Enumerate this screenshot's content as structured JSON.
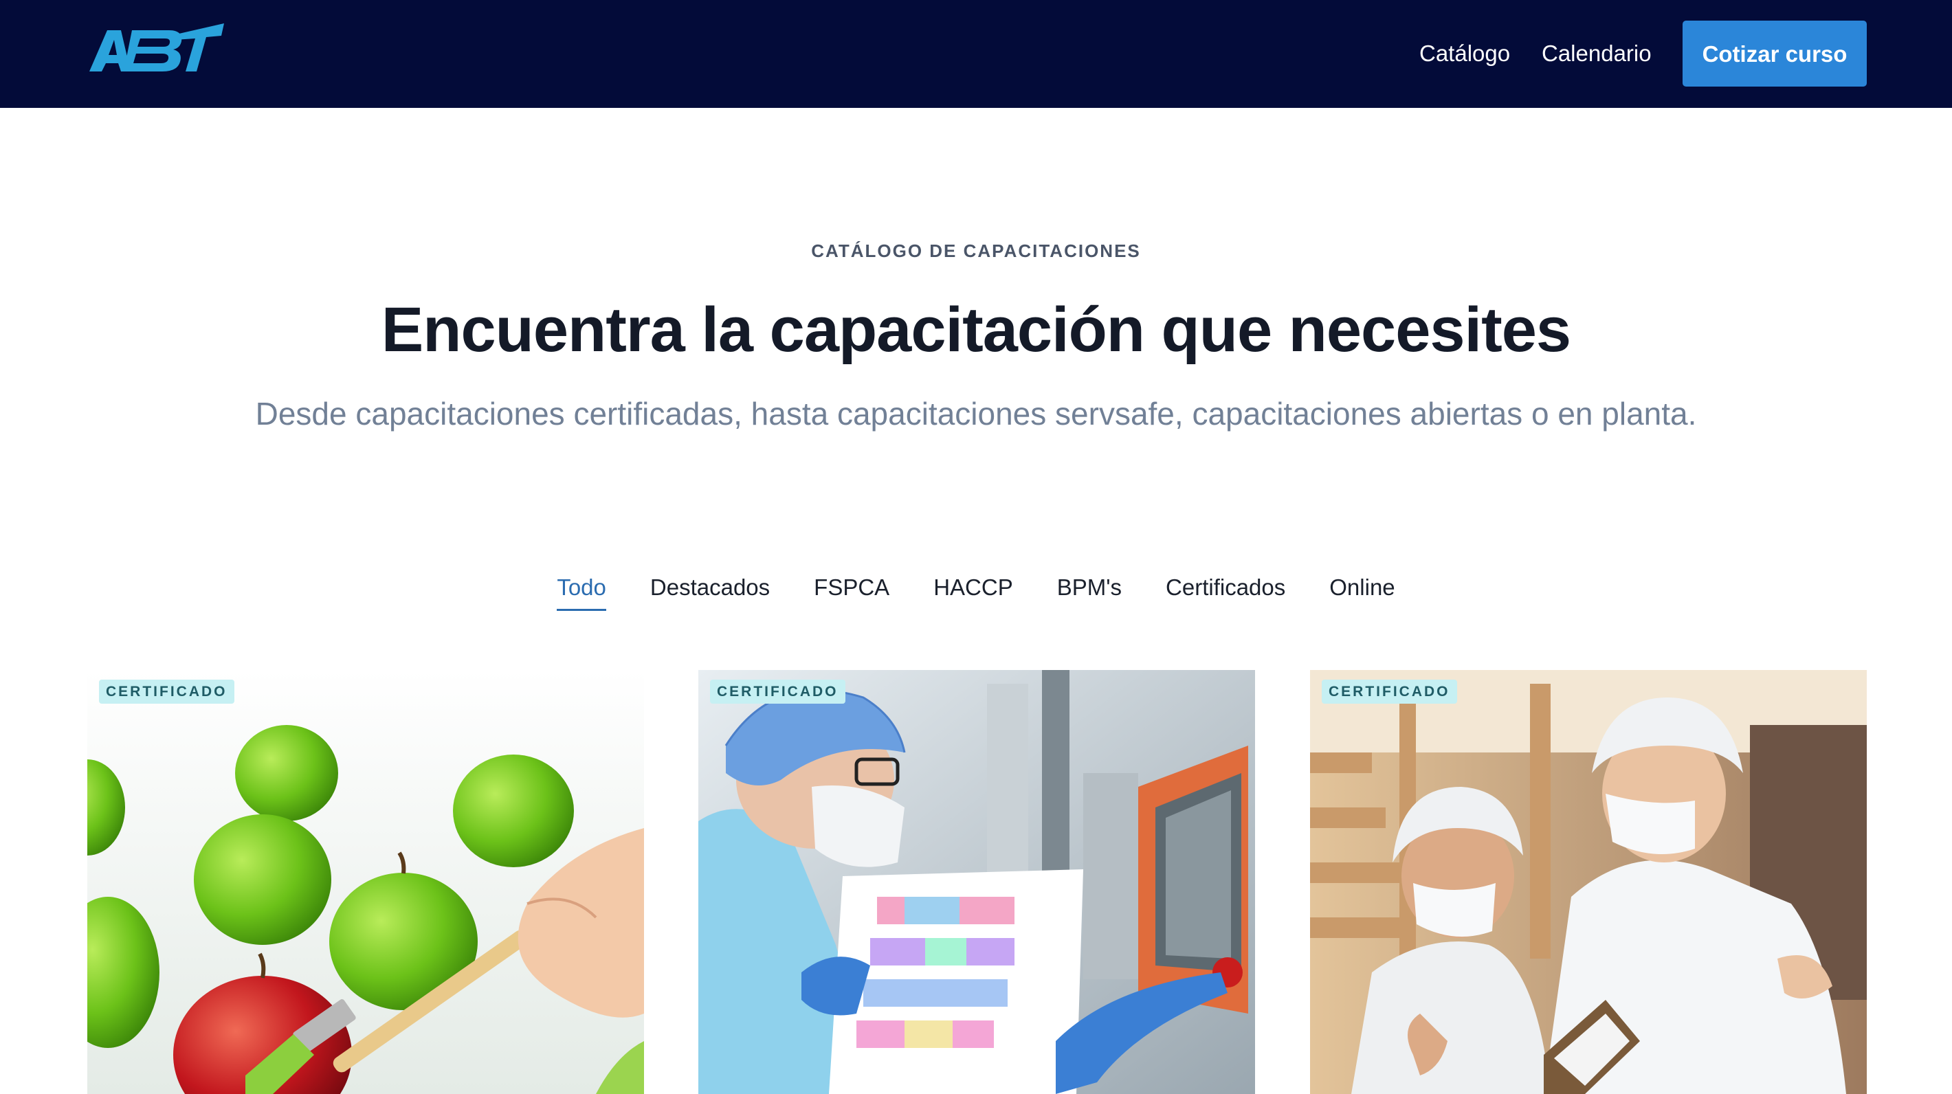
{
  "header": {
    "logo_text": "ABT",
    "nav": [
      {
        "label": "Catálogo"
      },
      {
        "label": "Calendario"
      }
    ],
    "cta_label": "Cotizar curso"
  },
  "hero": {
    "eyebrow": "CATÁLOGO DE CAPACITACIONES",
    "title": "Encuentra la capacitación que necesites",
    "subtitle": "Desde capacitaciones certificadas, hasta capacitaciones servsafe, capacitaciones abiertas o en planta."
  },
  "tabs": [
    {
      "label": "Todo",
      "active": true
    },
    {
      "label": "Destacados",
      "active": false
    },
    {
      "label": "FSPCA",
      "active": false
    },
    {
      "label": "HACCP",
      "active": false
    },
    {
      "label": "BPM's",
      "active": false
    },
    {
      "label": "Certificados",
      "active": false
    },
    {
      "label": "Online",
      "active": false
    }
  ],
  "cards": [
    {
      "badge": "CERTIFICADO",
      "image": "green-apples-painted-red-photo"
    },
    {
      "badge": "CERTIFICADO",
      "image": "lab-technician-hairnet-tablet-photo"
    },
    {
      "badge": "CERTIFICADO",
      "image": "two-workers-white-coats-factory-photo"
    }
  ],
  "colors": {
    "header_bg": "#030b39",
    "accent": "#2b86d9",
    "logo": "#2aa3dc",
    "badge_bg": "#c6f0f3",
    "active_tab": "#2b6cb0"
  }
}
